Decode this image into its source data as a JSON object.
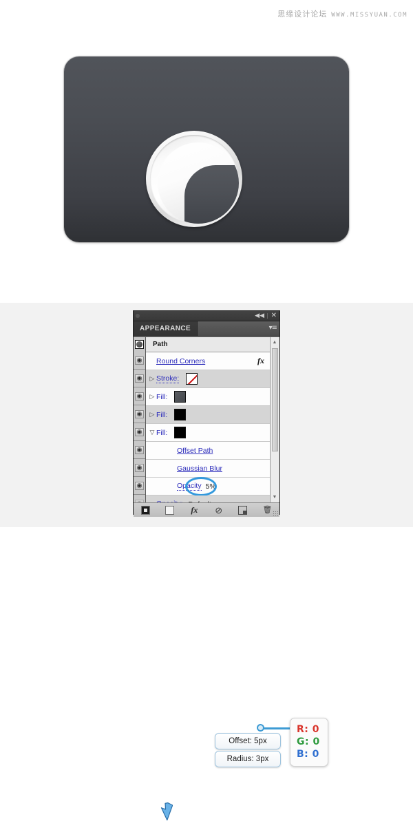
{
  "watermark": {
    "cjk": "思缘设计论坛",
    "latin": "WWW.MISSYUAN.COM"
  },
  "artwork": {
    "name": "rounded-dark-card-with-knob",
    "card_color_top": "#51545a",
    "card_color_bottom": "#2f3135",
    "ring_color": "#ffffff",
    "inner_shape_color": "#4d5056"
  },
  "panel": {
    "titlebar": {
      "collapse_label": "◀◀",
      "close_label": "✕"
    },
    "tab_label": "APPEARANCE",
    "menu_icon": "▾≡",
    "header": {
      "thumbnail_name": "path-thumbnail",
      "label": "Path"
    },
    "rows": [
      {
        "id": "round-corners",
        "label": "Round Corners",
        "label_style": "underline",
        "disclosure": "",
        "swatch": "",
        "fx": "fx",
        "value": "",
        "shaded": false,
        "indent": false,
        "eye": true,
        "eye_dim": false
      },
      {
        "id": "stroke",
        "label": "Stroke:",
        "label_style": "dotted",
        "disclosure": "▷",
        "swatch": "none",
        "fx": "",
        "value": "",
        "shaded": true,
        "indent": false,
        "eye": true,
        "eye_dim": false
      },
      {
        "id": "fill-1",
        "label": "Fill:",
        "label_style": "plain",
        "disclosure": "▷",
        "swatch": "gray",
        "fx": "",
        "value": "",
        "shaded": false,
        "indent": false,
        "eye": true,
        "eye_dim": false
      },
      {
        "id": "fill-2",
        "label": "Fill:",
        "label_style": "plain",
        "disclosure": "▷",
        "swatch": "black",
        "fx": "",
        "value": "",
        "shaded": true,
        "indent": false,
        "eye": true,
        "eye_dim": false
      },
      {
        "id": "fill-3-expanded",
        "label": "Fill:",
        "label_style": "plain",
        "disclosure": "▽",
        "swatch": "black",
        "fx": "",
        "value": "",
        "shaded": false,
        "indent": false,
        "eye": true,
        "eye_dim": false
      },
      {
        "id": "offset-path",
        "label": "Offset Path",
        "label_style": "underline",
        "disclosure": "",
        "swatch": "",
        "fx": "",
        "value": "",
        "shaded": false,
        "indent": true,
        "eye": true,
        "eye_dim": false
      },
      {
        "id": "gaussian-blur",
        "label": "Gaussian Blur",
        "label_style": "underline",
        "disclosure": "",
        "swatch": "",
        "fx": "",
        "value": "",
        "shaded": false,
        "indent": true,
        "eye": true,
        "eye_dim": false
      },
      {
        "id": "opacity-effect",
        "label": "Opacity",
        "label_style": "dotted",
        "disclosure": "",
        "swatch": "",
        "fx": "",
        "value": "5%",
        "shaded": false,
        "indent": true,
        "eye": true,
        "eye_dim": false,
        "highlight_circle": true
      },
      {
        "id": "opacity-default",
        "label": "Opacity:",
        "label_style": "dotted",
        "disclosure": "",
        "swatch": "",
        "fx": "",
        "value": "Default",
        "shaded": true,
        "indent": false,
        "eye": true,
        "eye_dim": true
      }
    ],
    "scrollbar": {
      "up_arrow": "▲",
      "down_arrow": "▼"
    },
    "toolbar": {
      "fill_swatch_label": "",
      "new_fill_label": "",
      "fx_label": "fx",
      "clear_label": "⊘",
      "duplicate_label": "",
      "trash_label": "🗑"
    }
  },
  "annotations": {
    "callout_offset": "Offset: 5px",
    "callout_radius": "Radius: 3px",
    "rgb": {
      "r_label": "R:",
      "r_value": "0",
      "g_label": "G:",
      "g_value": "0",
      "b_label": "B:",
      "b_value": "0",
      "r_color": "#d9352c",
      "g_color": "#2e9a3e",
      "b_color": "#2f6fd0"
    },
    "highlight_color": "#3d9bd4"
  }
}
